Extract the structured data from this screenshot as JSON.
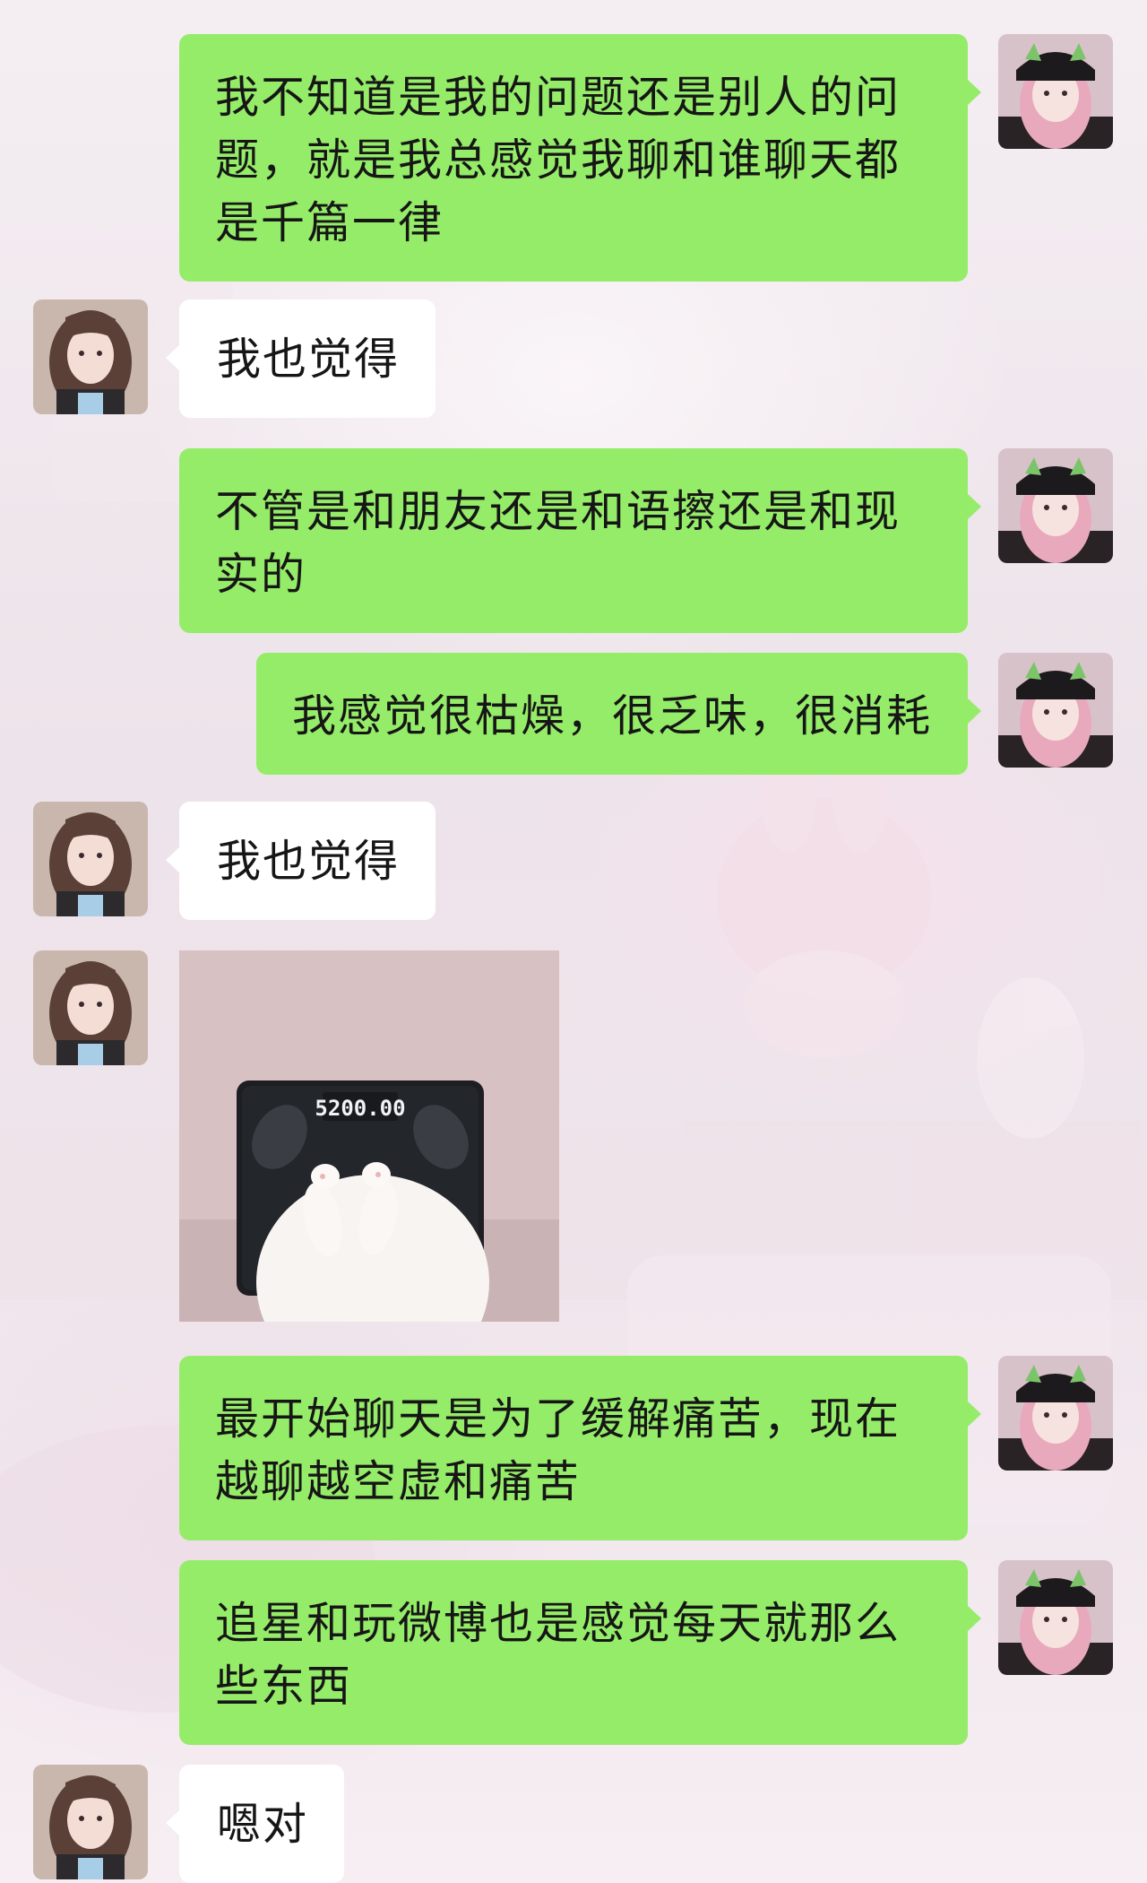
{
  "messages": [
    {
      "sender": "self",
      "type": "text",
      "text": "我不知道是我的问题还是别人的问题，就是我总感觉我聊和谁聊天都是千篇一律"
    },
    {
      "sender": "other",
      "type": "text",
      "text": "我也觉得"
    },
    {
      "sender": "self",
      "type": "text",
      "text": "不管是和朋友还是和语擦还是和现实的"
    },
    {
      "sender": "self",
      "type": "text",
      "text": "我感觉很枯燥，很乏味，很消耗"
    },
    {
      "sender": "other",
      "type": "text",
      "text": "我也觉得"
    },
    {
      "sender": "other",
      "type": "image",
      "scale_reading": "5200.00",
      "icon": "cat-on-scale-sticker"
    },
    {
      "sender": "self",
      "type": "text",
      "text": "最开始聊天是为了缓解痛苦，现在越聊越空虚和痛苦"
    },
    {
      "sender": "self",
      "type": "text",
      "text": "追星和玩微博也是感觉每天就那么些东西"
    },
    {
      "sender": "other",
      "type": "text",
      "text": "嗯对"
    }
  ],
  "colors": {
    "self_bubble": "#95ec69",
    "other_bubble": "#ffffff",
    "text": "#161616"
  }
}
